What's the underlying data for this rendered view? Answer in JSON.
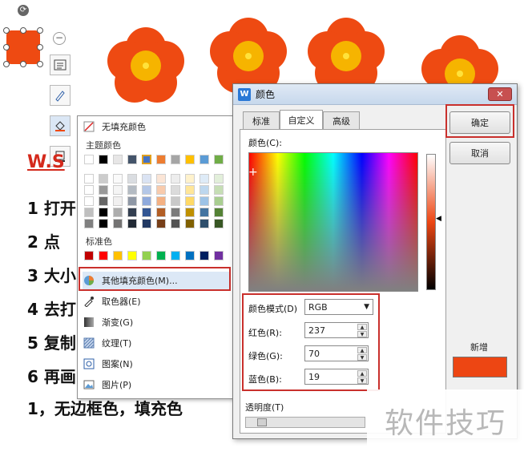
{
  "document": {
    "title": "W.S",
    "lines": [
      "1 打开",
      "2 点",
      "3 大小",
      "4 去打",
      "5 复制",
      "6 再画",
      "1，无边框色，填充色"
    ]
  },
  "side_toolbar": {
    "minus_glyph": "−",
    "rotate_glyph": "⟳"
  },
  "fill_menu": {
    "no_fill": "无填充颜色",
    "theme_colors_label": "主题颜色",
    "standard_colors_label": "标准色",
    "more_fill_colors": "其他填充颜色(M)...",
    "eyedropper": "取色器(E)",
    "gradient": "渐变(G)",
    "texture": "纹理(T)",
    "pattern": "图案(N)",
    "picture": "图片(P)",
    "theme_palette_top": [
      "#ffffff",
      "#000000",
      "#e7e6e6",
      "#44546a",
      "#4472c4",
      "#ed7d31",
      "#a5a5a5",
      "#ffc000",
      "#5b9bd5",
      "#70ad47"
    ],
    "standard_palette": [
      "#c00000",
      "#ff0000",
      "#ffc000",
      "#ffff00",
      "#92d050",
      "#00b050",
      "#00b0f0",
      "#0070c0",
      "#002060",
      "#7030a0"
    ]
  },
  "color_dialog": {
    "title": "颜色",
    "logo": "W",
    "close_glyph": "✕",
    "tabs": [
      "标准",
      "自定义",
      "高级"
    ],
    "active_tab": "自定义",
    "color_label": "颜色(C):",
    "color_mode_label": "颜色模式(D)",
    "color_mode_value": "RGB",
    "red_label": "红色(R):",
    "red_value": "237",
    "green_label": "绿色(G):",
    "green_value": "70",
    "blue_label": "蓝色(B):",
    "blue_value": "19",
    "ok_label": "确定",
    "cancel_label": "取消",
    "new_label": "新增",
    "new_color": "#ed4613",
    "transparency_label": "透明度(T)"
  },
  "watermark": "软件技巧",
  "colors": {
    "flower_petal": "#ee4a12",
    "flower_center": "#f6b400",
    "highlight_red": "#c9302c"
  }
}
